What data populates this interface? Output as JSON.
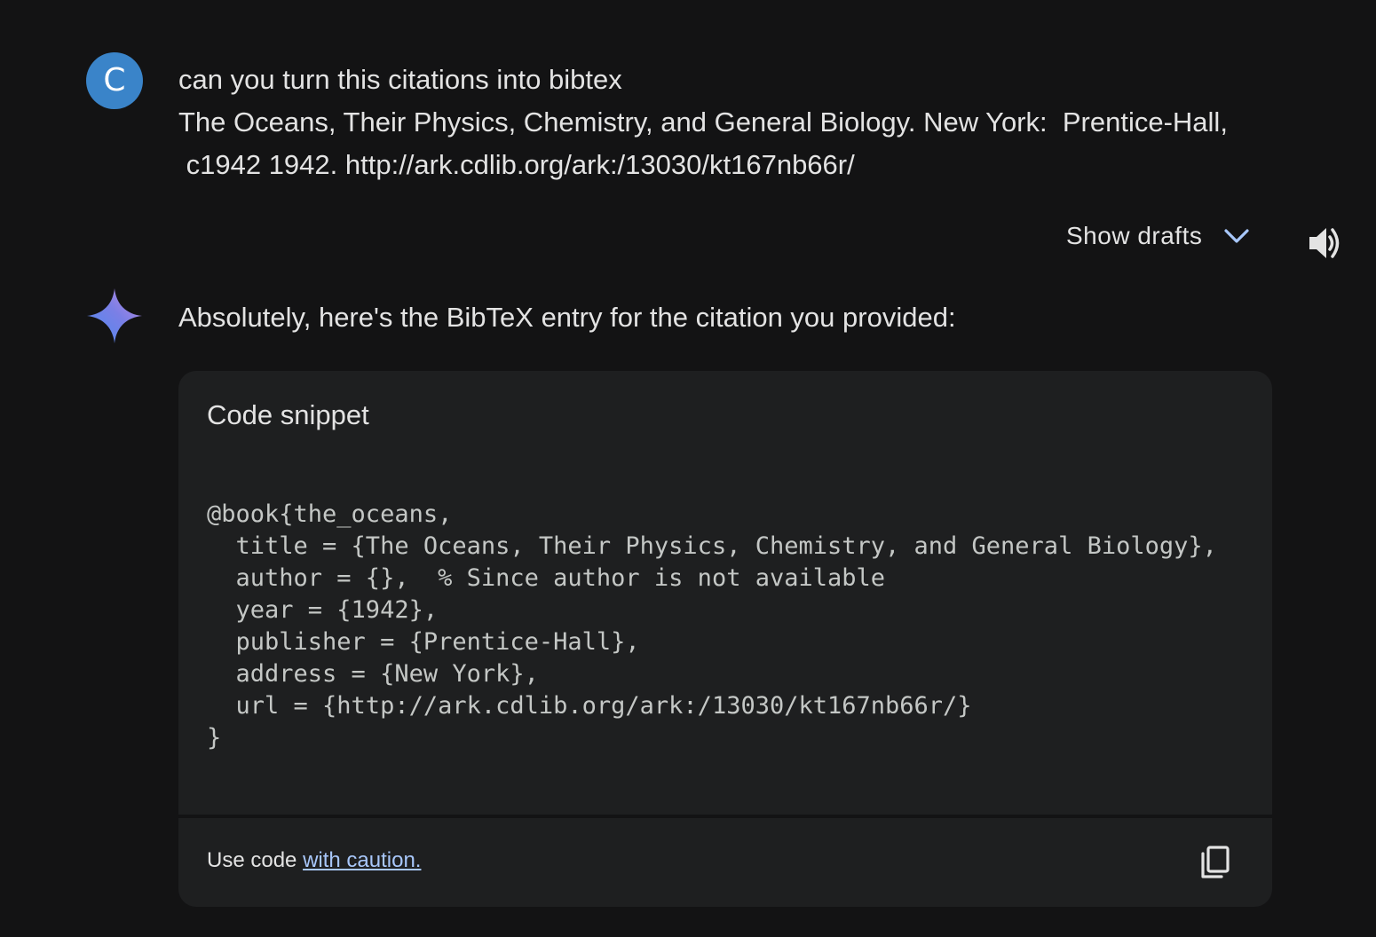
{
  "user": {
    "avatar_letter": "C",
    "message_lines": [
      "can you turn this citations into bibtex",
      "The Oceans, Their Physics, Chemistry, and General Biology. New York:  Prentice-Hall,",
      " c1942 1942. http://ark.cdlib.org/ark:/13030/kt167nb66r/"
    ]
  },
  "toolbar": {
    "show_drafts_label": "Show drafts",
    "chevron_icon": "chevron-down-icon",
    "speaker_icon": "volume-up-icon"
  },
  "response": {
    "logo_icon": "gemini-spark-icon",
    "intro": "Absolutely, here's the BibTeX entry for the citation you provided:",
    "code_block": {
      "title": "Code snippet",
      "code": "@book{the_oceans,\n  title = {The Oceans, Their Physics, Chemistry, and General Biology},\n  author = {},  % Since author is not available\n  year = {1942},\n  publisher = {Prentice-Hall},\n  address = {New York},\n  url = {http://ark.cdlib.org/ark:/13030/kt167nb66r/}\n}"
    },
    "footer": {
      "use_code_label": "Use code ",
      "caution_link": "with caution.",
      "copy_icon": "copy-icon"
    }
  },
  "colors": {
    "background": "#131314",
    "card": "#1e1f20",
    "avatar": "#3a84c9",
    "link": "#a8c7fa",
    "chevron": "#a8c7fa"
  }
}
